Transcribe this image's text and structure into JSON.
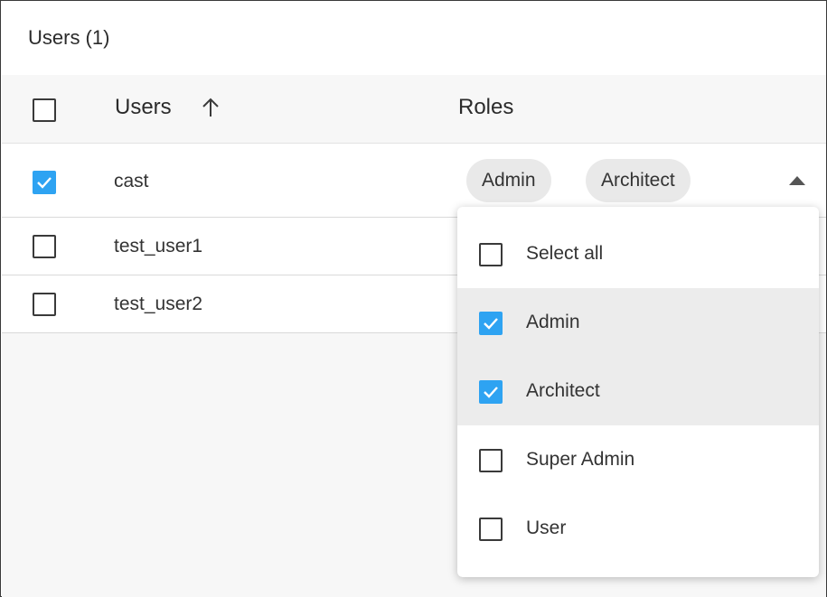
{
  "panel": {
    "title": "Users (1)"
  },
  "table": {
    "headers": {
      "users": "Users",
      "roles": "Roles"
    },
    "sort_icon": "arrow-up-icon",
    "rows": [
      {
        "name": "cast",
        "checked": true,
        "roles": [
          "Admin",
          "Architect"
        ]
      },
      {
        "name": "test_user1",
        "checked": false
      },
      {
        "name": "test_user2",
        "checked": false
      }
    ]
  },
  "roles_dropdown": {
    "expanded": true,
    "toggle_icon": "caret-up-icon",
    "options": [
      {
        "label": "Select all",
        "checked": false
      },
      {
        "label": "Admin",
        "checked": true
      },
      {
        "label": "Architect",
        "checked": true
      },
      {
        "label": "Super Admin",
        "checked": false
      },
      {
        "label": "User",
        "checked": false
      }
    ]
  },
  "colors": {
    "accent": "#2ea3f2",
    "chip_bg": "#e9e9e9",
    "header_bg": "#f7f7f7",
    "selected_option_bg": "#ececec"
  }
}
